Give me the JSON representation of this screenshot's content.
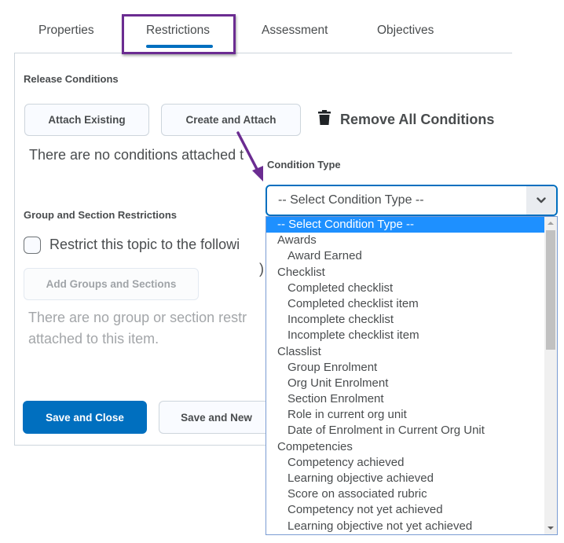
{
  "tabs": [
    {
      "label": "Properties",
      "active": false
    },
    {
      "label": "Restrictions",
      "active": true
    },
    {
      "label": "Assessment",
      "active": false
    },
    {
      "label": "Objectives",
      "active": false
    }
  ],
  "annotation": {
    "highlight_color": "#6b2c91",
    "arrow_color": "#6b2c91"
  },
  "release_conditions": {
    "heading": "Release Conditions",
    "attach_existing_label": "Attach Existing",
    "create_and_attach_label": "Create and Attach",
    "remove_all_label": "Remove All Conditions",
    "empty_message": "There are no conditions attached t"
  },
  "group_restrictions": {
    "heading": "Group and Section Restrictions",
    "checkbox_label": "Restrict this topic to the followi",
    "checkbox_checked": false,
    "add_groups_label": "Add Groups and Sections",
    "empty_message_line1": "There are no group or section restr",
    "empty_message_line2": "attached to this item."
  },
  "footer": {
    "save_close_label": "Save and Close",
    "save_new_label": "Save and New"
  },
  "condition_type": {
    "label": "Condition Type",
    "selected_value": "-- Select Condition Type --",
    "options": [
      {
        "label": "-- Select Condition Type --",
        "level": 0,
        "selected": true
      },
      {
        "label": "Awards",
        "level": 0,
        "group": true
      },
      {
        "label": "Award Earned",
        "level": 1
      },
      {
        "label": "Checklist",
        "level": 0,
        "group": true
      },
      {
        "label": "Completed checklist",
        "level": 1
      },
      {
        "label": "Completed checklist item",
        "level": 1
      },
      {
        "label": "Incomplete checklist",
        "level": 1
      },
      {
        "label": "Incomplete checklist item",
        "level": 1
      },
      {
        "label": "Classlist",
        "level": 0,
        "group": true
      },
      {
        "label": "Group Enrolment",
        "level": 1
      },
      {
        "label": "Org Unit Enrolment",
        "level": 1
      },
      {
        "label": "Section Enrolment",
        "level": 1
      },
      {
        "label": "Role in current org unit",
        "level": 1
      },
      {
        "label": "Date of Enrolment in Current Org Unit",
        "level": 1
      },
      {
        "label": "Competencies",
        "level": 0,
        "group": true
      },
      {
        "label": "Competency achieved",
        "level": 1
      },
      {
        "label": "Learning objective achieved",
        "level": 1
      },
      {
        "label": "Score on associated rubric",
        "level": 1
      },
      {
        "label": "Competency not yet achieved",
        "level": 1
      },
      {
        "label": "Learning objective not yet achieved",
        "level": 1
      }
    ]
  },
  "colors": {
    "primary": "#006fbf",
    "selected_option": "#1e90ff",
    "text": "#494c4e"
  }
}
